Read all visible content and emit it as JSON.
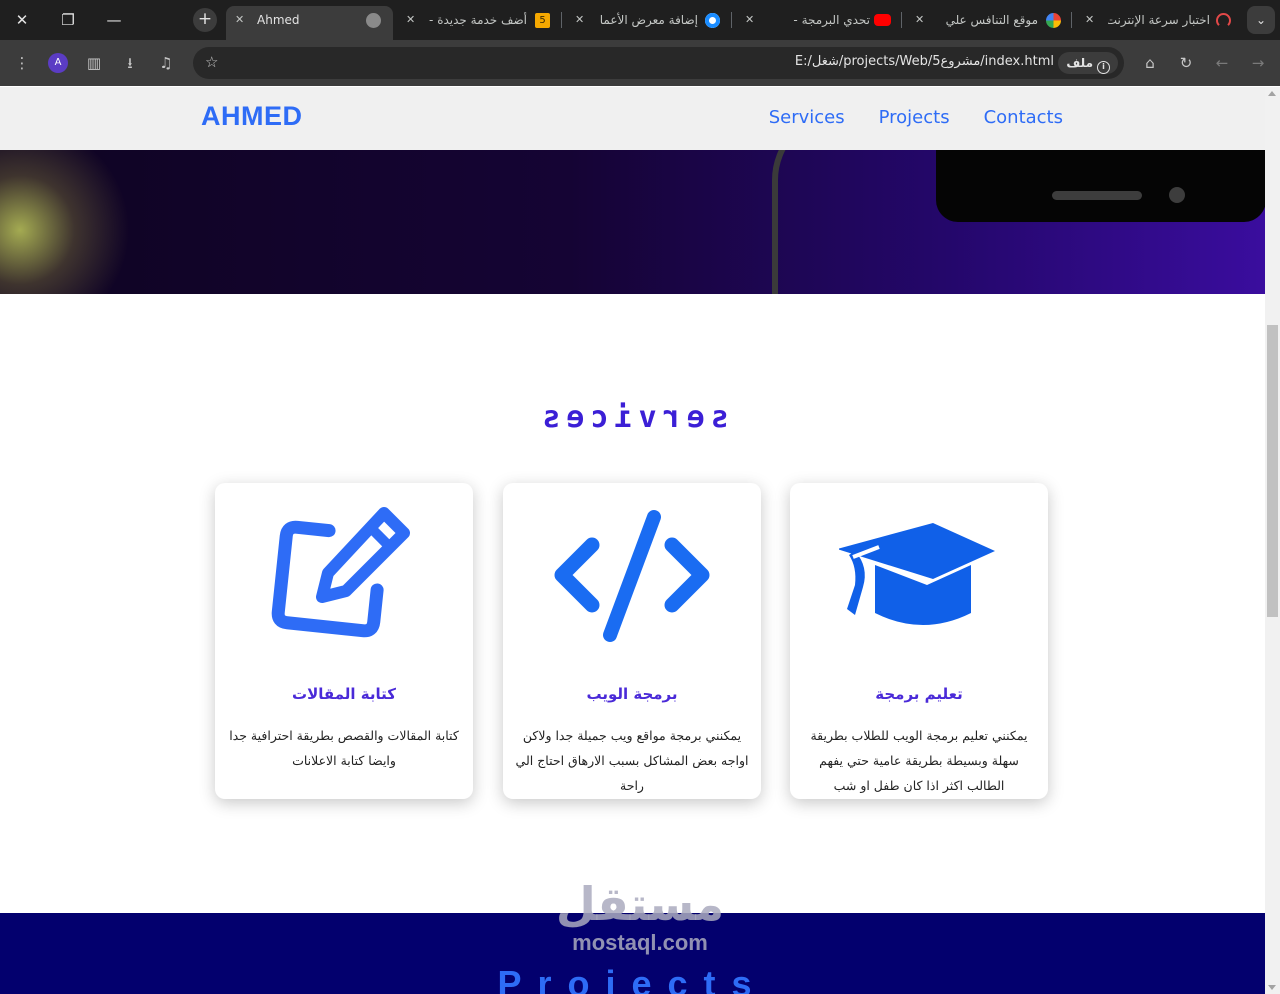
{
  "browser": {
    "tabs": [
      {
        "title": "اختبار سرعة الإنترنت",
        "favicon": "speedometer-icon",
        "active": false
      },
      {
        "title": "موقع التنافس علي",
        "favicon": "google-icon",
        "active": false
      },
      {
        "title": "تحدي البرمجة -",
        "favicon": "youtube-icon",
        "active": false
      },
      {
        "title": "إضافة معرض الأعما",
        "favicon": "circle-icon",
        "active": false
      },
      {
        "title": "أضف خدمة جديدة -",
        "favicon": "five-icon",
        "active": false
      },
      {
        "title": "Ahmed",
        "favicon": "globe-icon",
        "active": true
      }
    ],
    "new_tab": "+",
    "profile_initial": "A",
    "address": {
      "scheme_chip": "ملف",
      "url": "E:/شغل/projects/Web/5مشروع/index.html"
    }
  },
  "site": {
    "brand": "AHMED",
    "nav": [
      "Services",
      "Projects",
      "Contacts"
    ],
    "services_title": "services",
    "cards": [
      {
        "icon": "edit-pencil-icon",
        "title": "كتابة المقالات",
        "text": "كتابة المقالات والقصص بطريقة احترافية جدا وايضا كتابة الاعلانات"
      },
      {
        "icon": "code-icon",
        "title": "برمجة الويب",
        "text": "يمكنني برمجة مواقع ويب جميلة جدا ولاكن اواجه بعض المشاكل بسبب الارهاق احتاج الي راحة"
      },
      {
        "icon": "graduation-cap-icon",
        "title": "تعليم برمجة",
        "text": "يمكنني تعليم برمجة الويب للطلاب بطريقة سهلة وبسيطة بطريقة عامية حتي يفهم الطالب اكثر اذا كان طفل او شب"
      }
    ],
    "projects_title": "Projects",
    "watermark": {
      "arabic": "مستقل",
      "latin": "mostaql.com"
    }
  },
  "colors": {
    "accent": "#2e6cf6",
    "heading_purple": "#4a2ad8",
    "projects_band": "#03006e"
  }
}
